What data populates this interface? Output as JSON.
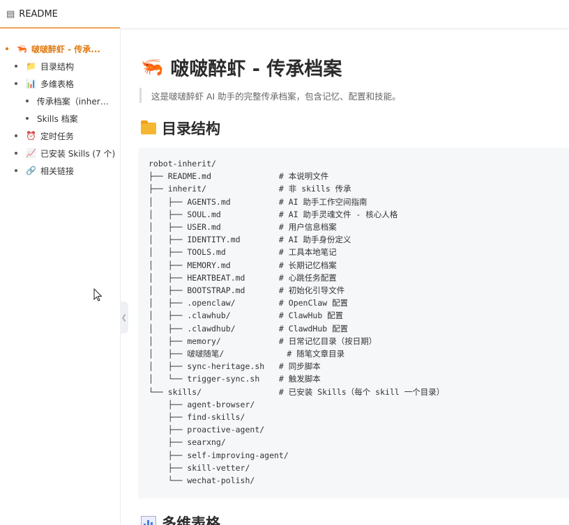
{
  "tab": {
    "title": "README"
  },
  "toc": [
    {
      "label": "啵啵醉虾 - 传承...",
      "icon": "🦐",
      "active": true
    },
    {
      "label": "目录结构",
      "icon": "📁"
    },
    {
      "label": "多维表格",
      "icon": "📊"
    },
    {
      "label": "传承档案（inherit...",
      "icon": ""
    },
    {
      "label": "Skills 档案",
      "icon": ""
    },
    {
      "label": "定时任务",
      "icon": "⏰"
    },
    {
      "label": "已安装 Skills (7 个)",
      "icon": "📈"
    },
    {
      "label": "相关链接",
      "icon": "🔗"
    }
  ],
  "doc": {
    "title": "啵啵醉虾 - 传承档案",
    "title_icon": "🦐",
    "quote": "这是啵啵醉虾 AI 助手的完整传承档案，包含记忆、配置和技能。",
    "section1": "目录结构",
    "section2": "多维表格",
    "tree": [
      "robot-inherit/",
      "├── README.md              # 本说明文件",
      "├── inherit/               # 非 skills 传承",
      "│   ├── AGENTS.md          # AI 助手工作空间指南",
      "│   ├── SOUL.md            # AI 助手灵魂文件 - 核心人格",
      "│   ├── USER.md            # 用户信息档案",
      "│   ├── IDENTITY.md        # AI 助手身份定义",
      "│   ├── TOOLS.md           # 工具本地笔记",
      "│   ├── MEMORY.md          # 长期记忆档案",
      "│   ├── HEARTBEAT.md       # 心跳任务配置",
      "│   ├── BOOTSTRAP.md       # 初始化引导文件",
      "│   ├── .openclaw/         # OpenClaw 配置",
      "│   ├── .clawhub/          # ClawHub 配置",
      "│   ├── .clawdhub/         # ClawdHub 配置",
      "│   ├── memory/            # 日常记忆目录（按日期）",
      "│   ├── 啵啵随笔/             # 随笔文章目录",
      "│   ├── sync-heritage.sh   # 同步脚本",
      "│   └── trigger-sync.sh    # 触发脚本",
      "└── skills/                # 已安装 Skills（每个 skill 一个目录）",
      "    ├── agent-browser/",
      "    ├── find-skills/",
      "    ├── proactive-agent/",
      "    ├── searxng/",
      "    ├── self-improving-agent/",
      "    ├── skill-vetter/",
      "    └── wechat-polish/"
    ]
  },
  "colors": {
    "accent": "#e07a12",
    "underline": "#f1a25a",
    "code_bg": "#f6f7f9"
  }
}
